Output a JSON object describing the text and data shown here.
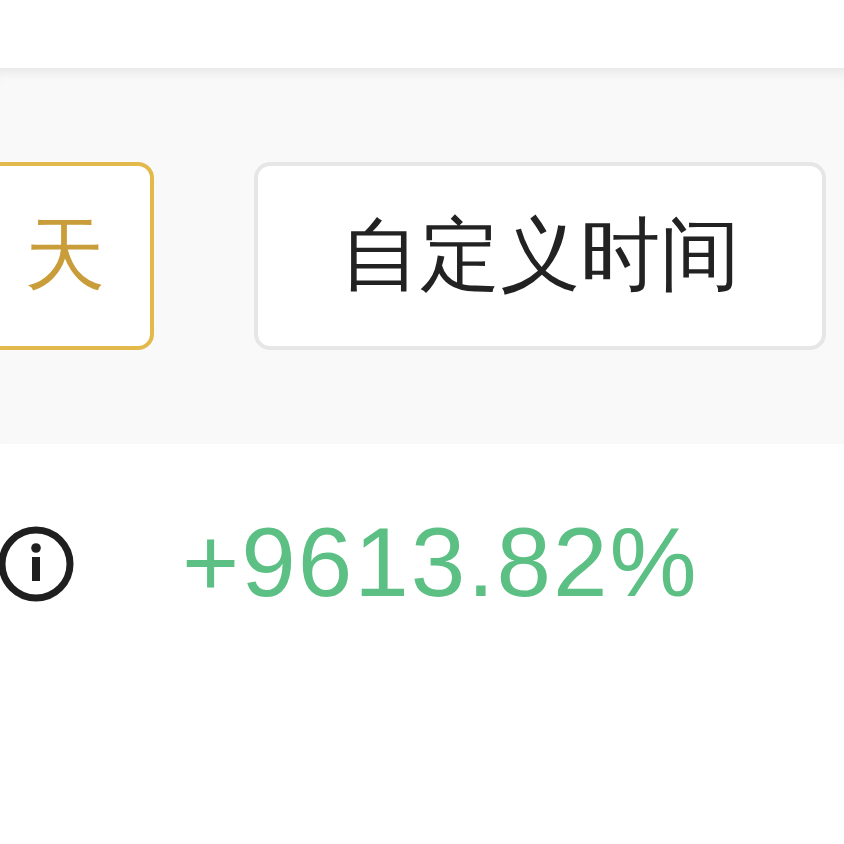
{
  "time_tabs": [
    {
      "label": "天",
      "selected": true
    },
    {
      "label": "自定义时间",
      "selected": false
    }
  ],
  "return_rate": {
    "value": "+9613.82%"
  }
}
